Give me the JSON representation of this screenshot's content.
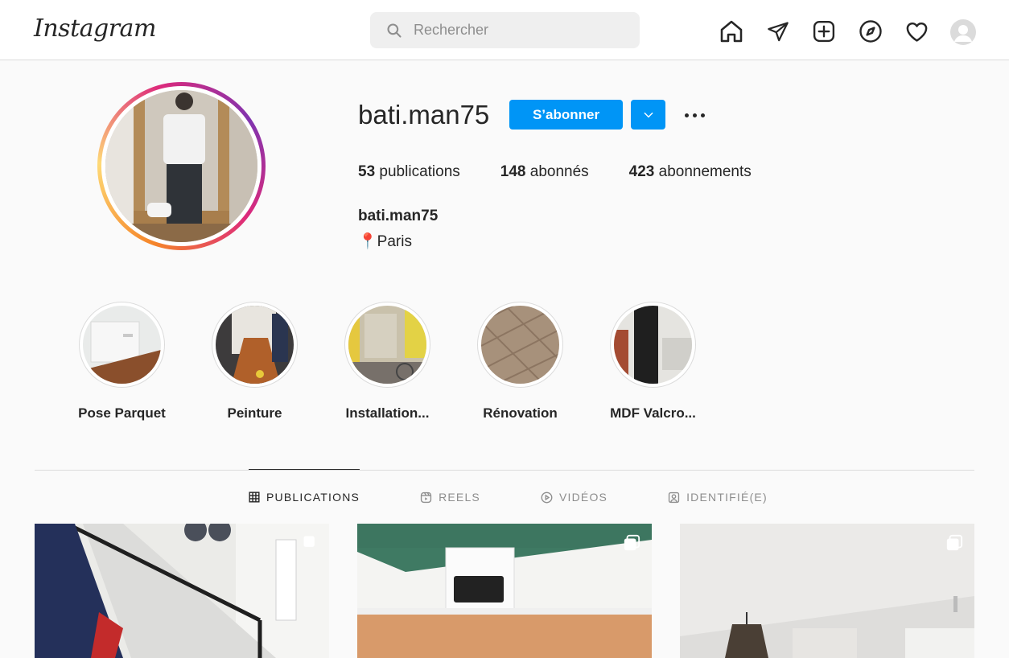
{
  "header": {
    "logo": "Instagram",
    "search_placeholder": "Rechercher"
  },
  "profile": {
    "username": "bati.man75",
    "follow_label": "S’abonner",
    "stats": [
      {
        "count": "53",
        "label": "publications"
      },
      {
        "count": "148",
        "label": "abonnés"
      },
      {
        "count": "423",
        "label": "abonnements"
      }
    ],
    "full_name": "bati.man75",
    "location": "📍Paris"
  },
  "highlights": [
    {
      "label": "Pose Parquet"
    },
    {
      "label": "Peinture"
    },
    {
      "label": "Installation..."
    },
    {
      "label": "Rénovation"
    },
    {
      "label": "MDF Valcro..."
    }
  ],
  "tabs": [
    {
      "label": "PUBLICATIONS",
      "icon": "grid-icon",
      "active": true
    },
    {
      "label": "REELS",
      "icon": "reels-icon",
      "active": false
    },
    {
      "label": "VIDÉOS",
      "icon": "play-icon",
      "active": false
    },
    {
      "label": "IDENTIFIÉ(E)",
      "icon": "tagged-icon",
      "active": false
    }
  ],
  "colors": {
    "accent": "#0095f6",
    "text": "#262626",
    "muted": "#8e8e8e",
    "border": "#dbdbdb"
  }
}
